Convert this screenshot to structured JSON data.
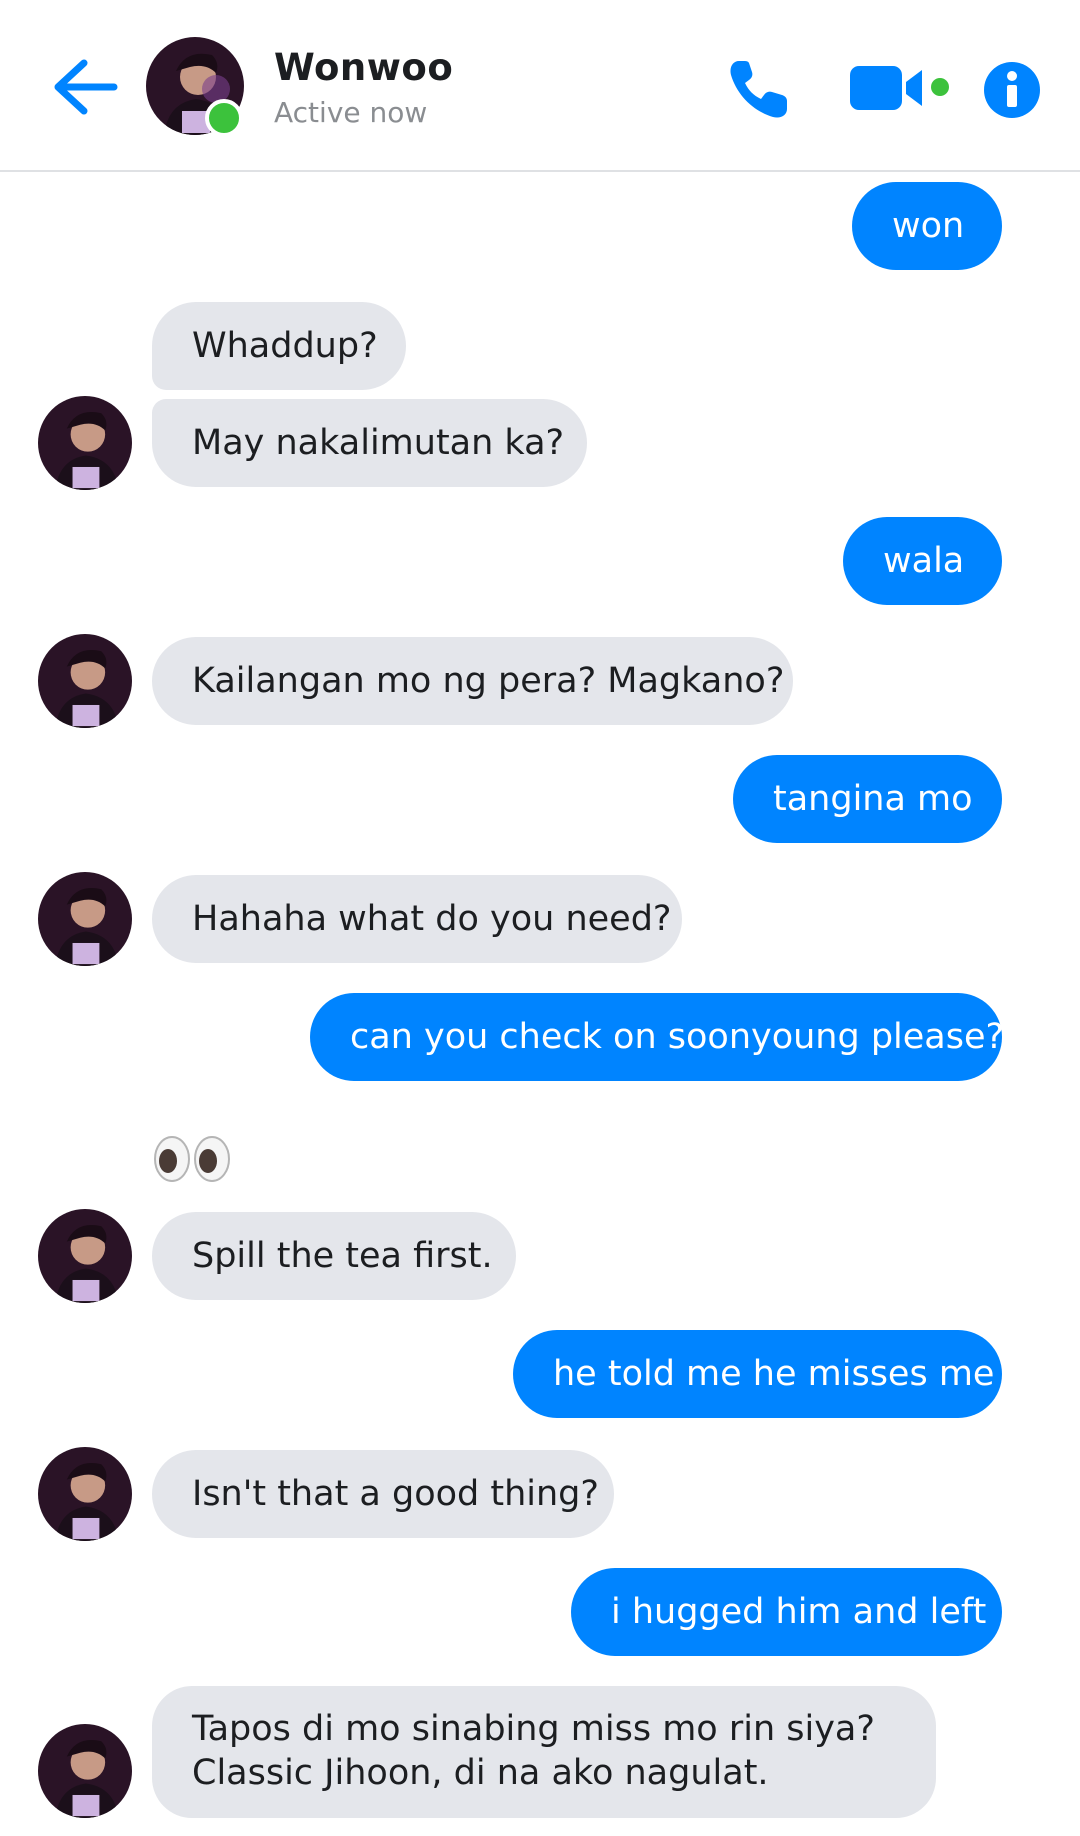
{
  "header": {
    "contact_name": "Wonwoo",
    "status": "Active now",
    "accent_color": "#0084ff",
    "online_color": "#3cc23c"
  },
  "icons": {
    "back": "arrow-left",
    "call": "phone",
    "video": "video-camera",
    "info": "info-circle",
    "reaction": "eyes-emoji"
  },
  "messages": [
    {
      "from": "me",
      "text": "won"
    },
    {
      "from": "them",
      "text": "Whaddup?"
    },
    {
      "from": "them",
      "text": "May nakalimutan ka?"
    },
    {
      "from": "me",
      "text": "wala"
    },
    {
      "from": "them",
      "text": "Kailangan mo ng pera? Magkano?"
    },
    {
      "from": "me",
      "text": "tangina mo"
    },
    {
      "from": "them",
      "text": "Hahaha what do you need?"
    },
    {
      "from": "me",
      "text": "can you check on soonyoung please?"
    },
    {
      "from": "them",
      "text": "👀"
    },
    {
      "from": "them",
      "text": "Spill the tea first."
    },
    {
      "from": "me",
      "text": "he told me he misses me"
    },
    {
      "from": "them",
      "text": "Isn't that a good thing?"
    },
    {
      "from": "me",
      "text": "i hugged him and left"
    },
    {
      "from": "them",
      "text": "Tapos di mo sinabing miss mo rin siya?",
      "text2": "Classic Jihoon, di na ako nagulat."
    }
  ]
}
